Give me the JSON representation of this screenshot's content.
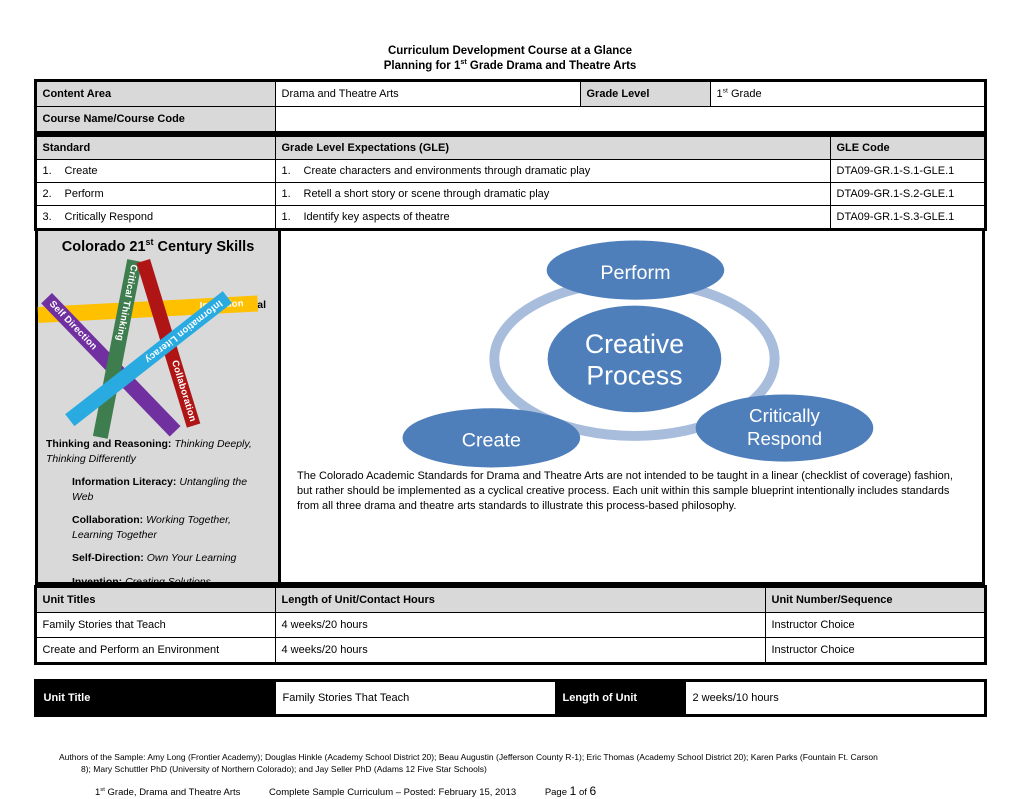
{
  "title": {
    "line1": "Curriculum Development Course at a Glance",
    "line2_pre": "Planning for 1",
    "line2_sup": "st",
    "line2_post": " Grade Drama and Theatre Arts"
  },
  "content_area_table": {
    "content_area_label": "Content Area",
    "content_area_value": "Drama and Theatre Arts",
    "grade_level_label": "Grade Level",
    "grade_level_value_pre": "1",
    "grade_level_value_sup": "st",
    "grade_level_value_post": " Grade",
    "course_name_label": "Course Name/Course Code",
    "course_name_value": ""
  },
  "standards_table": {
    "headers": {
      "standard": "Standard",
      "gle": "Grade Level Expectations (GLE)",
      "gle_code": "GLE Code"
    },
    "rows": [
      {
        "num": "1.",
        "standard": "Create",
        "gle_num": "1.",
        "gle": "Create characters and environments through dramatic play",
        "code": "DTA09-GR.1-S.1-GLE.1"
      },
      {
        "num": "2.",
        "standard": "Perform",
        "gle_num": "1.",
        "gle": "Retell a short story or scene through dramatic play",
        "code": "DTA09-GR.1-S.2-GLE.1"
      },
      {
        "num": "3.",
        "standard": "Critically Respond",
        "gle_num": "1.",
        "gle": "Identify key aspects of theatre",
        "code": "DTA09-GR.1-S.3-GLE.1"
      }
    ]
  },
  "skills_panel": {
    "title_pre": "Colorado 21",
    "title_sup": "st",
    "title_post": " Century Skills",
    "critical_word": "Critical",
    "bands": [
      {
        "label": "Self Direction",
        "color": "#7030A0"
      },
      {
        "label": "Critical Thinking",
        "color": "#3E7D4E"
      },
      {
        "label": "Invention",
        "color": "#FFC000"
      },
      {
        "label": "Information Literacy",
        "color": "#29ABE2"
      },
      {
        "label": "Collaboration",
        "color": "#B01515"
      }
    ],
    "descriptions": [
      {
        "term": "Thinking and Reasoning:",
        "definition": "Thinking Deeply, Thinking Differently",
        "indent": false
      },
      {
        "term": "Information Literacy:",
        "definition": "Untangling the Web",
        "indent": true
      },
      {
        "term": "Collaboration:",
        "definition": "Working Together, Learning Together",
        "indent": true
      },
      {
        "term": "Self-Direction:",
        "definition": "Own Your Learning",
        "indent": true
      },
      {
        "term": "Invention:",
        "definition": "Creating Solutions",
        "indent": true
      }
    ]
  },
  "creative_process": {
    "center_line1": "Creative",
    "center_line2": "Process",
    "node_perform": "Perform",
    "node_create": "Create",
    "node_respond_line1": "Critically",
    "node_respond_line2": "Respond",
    "ellipse_color": "#4F7FBA",
    "ring_color": "#A8BCDC",
    "paragraph": "The Colorado Academic Standards for Drama and Theatre Arts are not intended to be taught in a linear (checklist of coverage) fashion, but rather should be implemented as a cyclical creative process. Each unit within this sample blueprint intentionally includes standards from all three drama and theatre arts standards to illustrate this process-based philosophy."
  },
  "units_table": {
    "headers": {
      "unit_titles": "Unit Titles",
      "length": "Length of Unit/Contact Hours",
      "sequence": "Unit Number/Sequence"
    },
    "rows": [
      {
        "title": "Family Stories that Teach",
        "length": "4 weeks/20 hours",
        "sequence": "Instructor Choice"
      },
      {
        "title": "Create and Perform an Environment",
        "length": "4 weeks/20 hours",
        "sequence": "Instructor Choice"
      }
    ]
  },
  "unit_title_bar": {
    "unit_title_label": "Unit Title",
    "unit_title_value": "Family Stories That Teach",
    "length_label": "Length of Unit",
    "length_value": "2 weeks/10 hours"
  },
  "footer": {
    "authors_line1": "Authors of the Sample: Amy Long (Frontier Academy); Douglas Hinkle (Academy School District 20); Beau Augustin (Jefferson County R-1); Eric Thomas (Academy School District 20); Karen Parks (Fountain Ft. Carson",
    "authors_line2": "8); Mary Schuttler PhD (University of Northern Colorado); and Jay Seller PhD (Adams 12 Five Star Schools)",
    "grade_pre": "1",
    "grade_sup": "st",
    "grade_post": " Grade, Drama and Theatre Arts",
    "curriculum": "Complete Sample Curriculum – Posted: February 15, 2013",
    "page_word": "Page",
    "page_num": "1",
    "page_of": "of",
    "page_total": "6"
  }
}
